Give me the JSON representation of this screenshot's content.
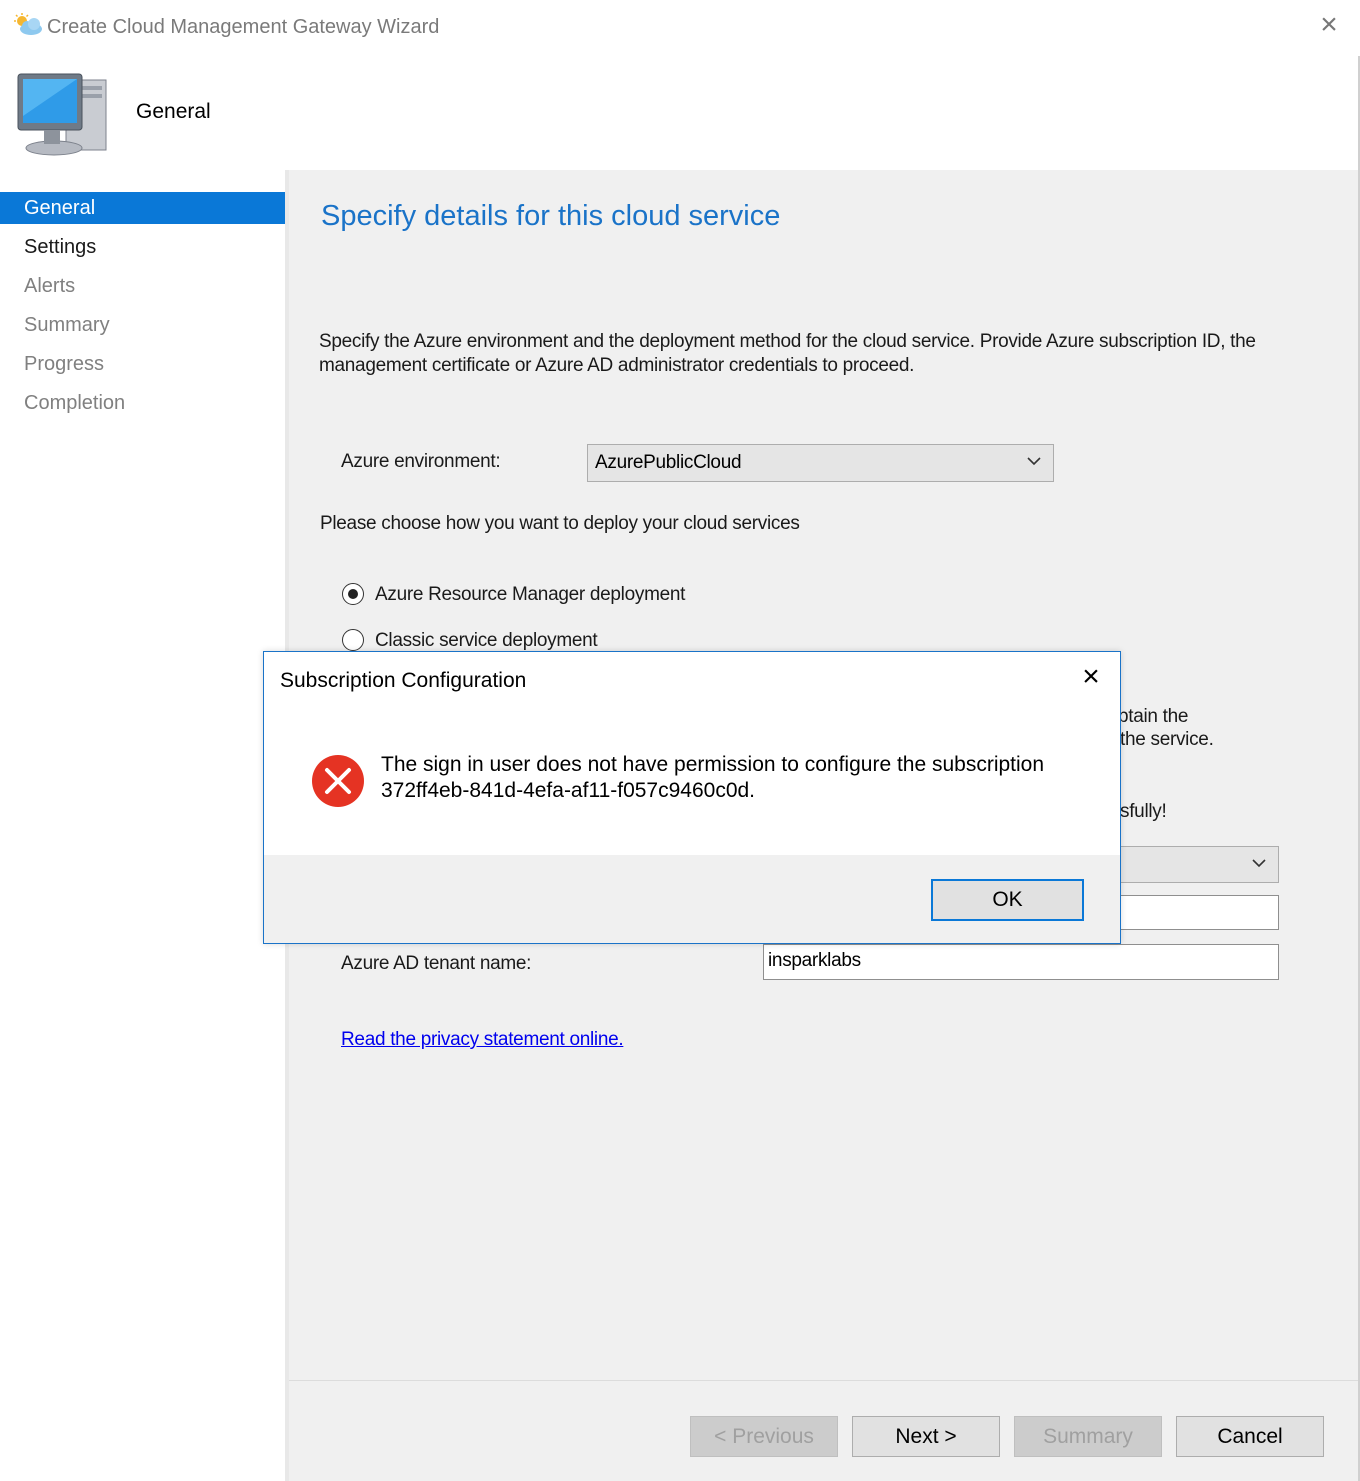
{
  "window": {
    "title": "Create Cloud Management Gateway Wizard",
    "header_title": "General"
  },
  "sidebar": {
    "items": [
      {
        "label": "General",
        "active": true
      },
      {
        "label": "Settings"
      },
      {
        "label": "Alerts"
      },
      {
        "label": "Summary"
      },
      {
        "label": "Progress"
      },
      {
        "label": "Completion"
      }
    ]
  },
  "main": {
    "heading": "Specify details for this cloud service",
    "description": "Specify the Azure environment and the deployment method for the cloud service. Provide Azure subscription ID, the management certificate or Azure AD administrator credentials to proceed.",
    "azure_env_label": "Azure environment:",
    "azure_env_value": "AzurePublicCloud",
    "deploy_prompt": "Please choose how you want to deploy your cloud services",
    "radio_arm": "Azure Resource Manager deployment",
    "radio_classic": "Classic service deployment",
    "partial_text_1": "btain the",
    "partial_text_2": "the service.",
    "partial_text_3": "sfully!",
    "tenant_label": "Azure AD tenant name:",
    "tenant_value": "insparklabs",
    "privacy_link": "Read the privacy statement online."
  },
  "buttons": {
    "previous": "< Previous",
    "next": "Next >",
    "summary": "Summary",
    "cancel": "Cancel"
  },
  "dialog": {
    "title": "Subscription Configuration",
    "message_line1": "The sign in user does not have permission to configure the subscription",
    "message_line2": "372ff4eb-841d-4efa-af11-f057c9460c0d.",
    "ok": "OK"
  },
  "colors": {
    "accent": "#0a78d7",
    "heading_blue": "#1a73c8",
    "error_red": "#e53323"
  }
}
